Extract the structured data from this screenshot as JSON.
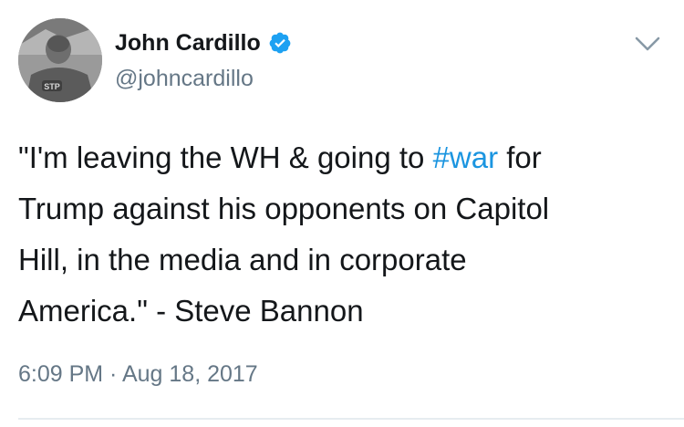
{
  "author": {
    "name": "John Cardillo",
    "handle": "@johncardillo",
    "verified": true,
    "avatar_shirt_text": "STP"
  },
  "tweet": {
    "line1_before": "\"I'm leaving the WH & going to ",
    "hashtag": "#war",
    "line1_after": " for",
    "line2": "Trump against his opponents on Capitol",
    "line3": "Hill, in the media and in corporate",
    "line4": "America.\" - Steve Bannon"
  },
  "meta": {
    "time": "6:09 PM",
    "separator": " · ",
    "date": "Aug 18, 2017"
  },
  "icons": {
    "verified": "verified-badge-icon",
    "menu": "chevron-down-icon"
  },
  "colors": {
    "text": "#14171a",
    "secondary": "#657786",
    "link": "#1b95e0",
    "verified": "#1da1f2",
    "divider": "#e6ecf0"
  }
}
